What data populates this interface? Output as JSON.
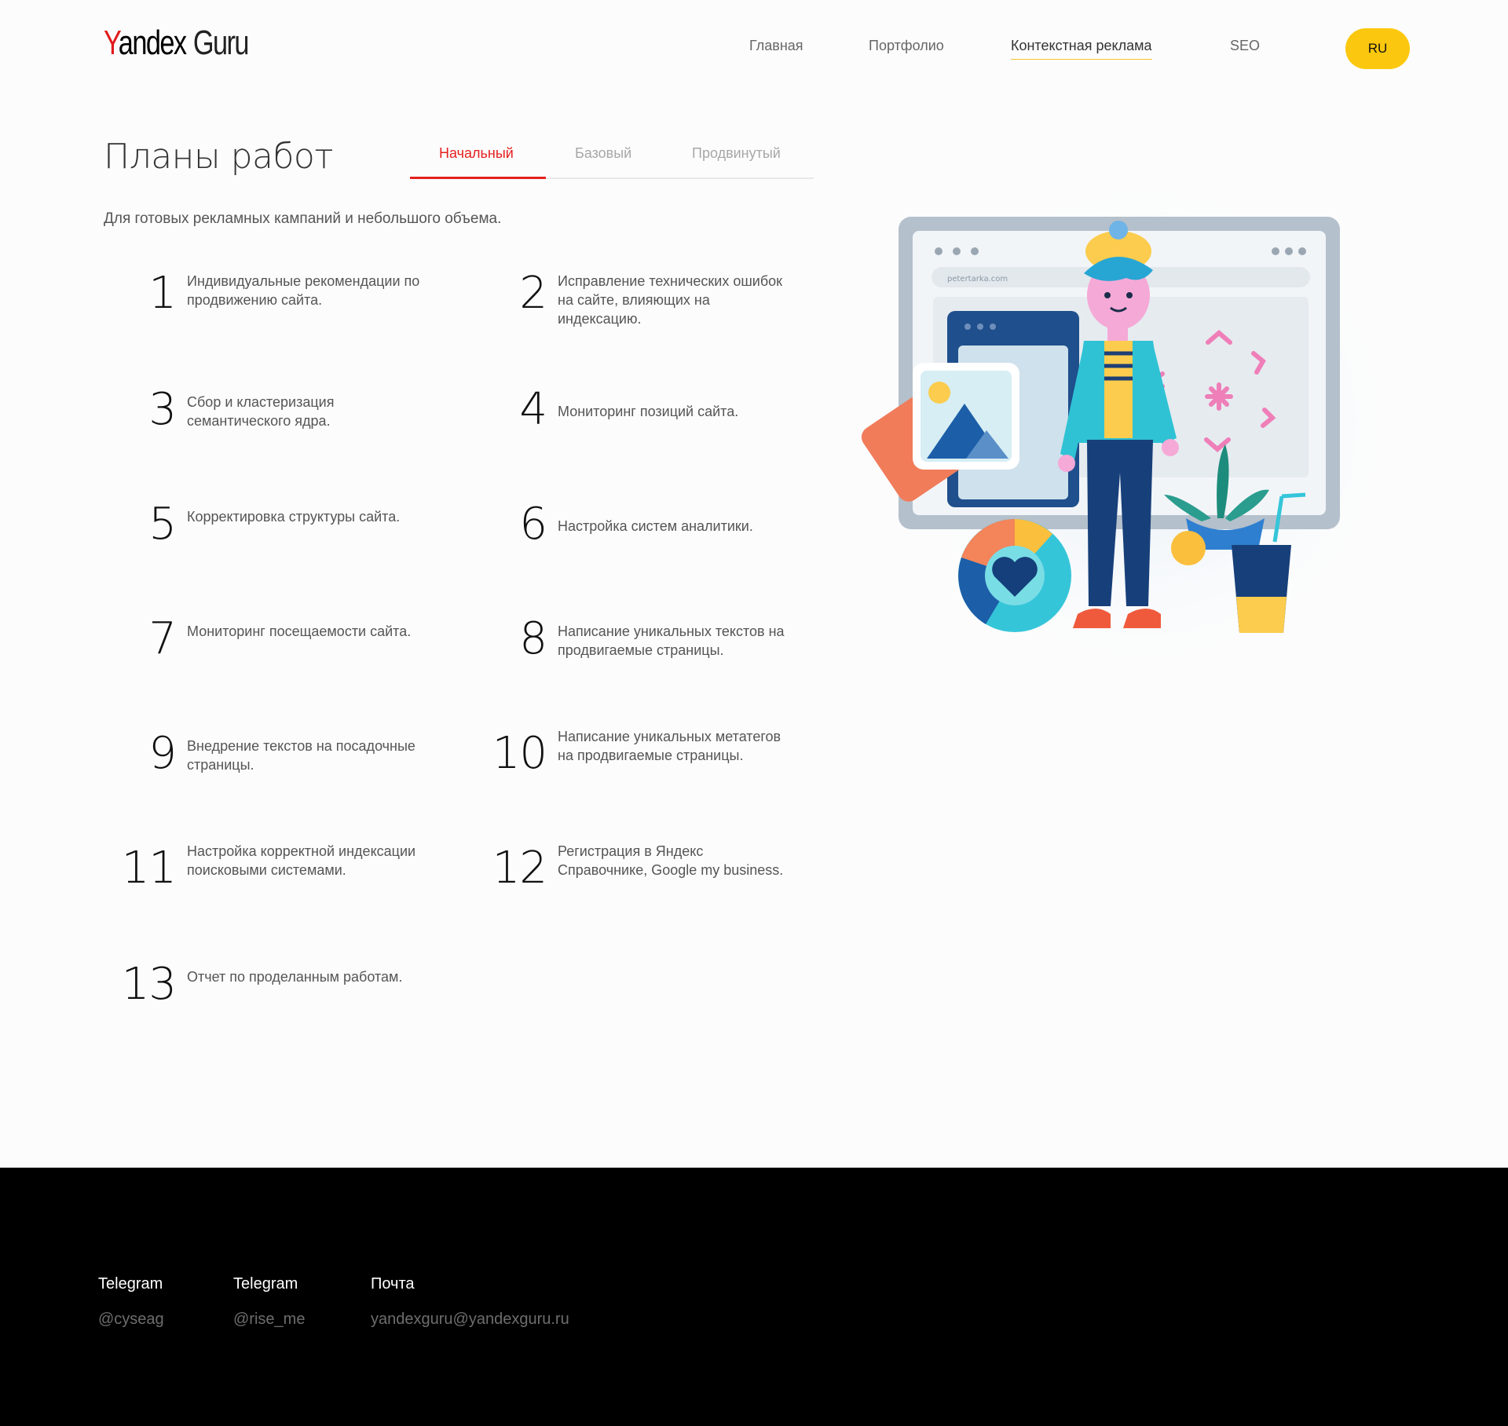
{
  "header": {
    "logo": {
      "y": "Y",
      "rest": "andex",
      "guru": "Guru"
    },
    "nav": [
      {
        "label": "Главная"
      },
      {
        "label": "Портфолио"
      },
      {
        "label": "Контекстная реклама"
      },
      {
        "label": "SEO"
      }
    ],
    "lang": "RU",
    "accent_color": "#fcc80f"
  },
  "plans": {
    "title": "Планы работ",
    "tabs": [
      {
        "label": "Начальный"
      },
      {
        "label": "Базовый"
      },
      {
        "label": "Продвинутый"
      }
    ],
    "active_tab_color": "#e5201f",
    "description": "Для готовых рекламных кампаний и небольшого объема.",
    "features": [
      {
        "num": "1",
        "text": "Индивидуальные рекомендации по продвижению сайта."
      },
      {
        "num": "2",
        "text": "Исправление технических ошибок на сайте, влияющих на индексацию."
      },
      {
        "num": "3",
        "text": "Сбор и кластеризация семантического ядра."
      },
      {
        "num": "4",
        "text": "Мониторинг позиций сайта."
      },
      {
        "num": "5",
        "text": "Корректировка структуры сайта."
      },
      {
        "num": "6",
        "text": "Настройка систем аналитики."
      },
      {
        "num": "7",
        "text": "Мониторинг посещаемости сайта."
      },
      {
        "num": "8",
        "text": "Написание уникальных текстов на продвигаемые страницы."
      },
      {
        "num": "9",
        "text": "Внедрение текстов на посадочные страницы."
      },
      {
        "num": "10",
        "text": "Написание уникальных метатегов на продвигаемые страницы."
      },
      {
        "num": "11",
        "text": "Настройка корректной индексации поисковыми системами."
      },
      {
        "num": "12",
        "text": "Регистрация в Яндекс Справочнике, Google my business."
      },
      {
        "num": "13",
        "text": "Отчет по проделанным работам."
      }
    ]
  },
  "illustration": {
    "browser_url": "petertarka.com"
  },
  "footer": {
    "columns": [
      {
        "title": "Telegram",
        "value": "@cyseag"
      },
      {
        "title": "Telegram",
        "value": "@rise_me"
      },
      {
        "title": "Почта",
        "value": "yandexguru@yandexguru.ru"
      }
    ]
  }
}
